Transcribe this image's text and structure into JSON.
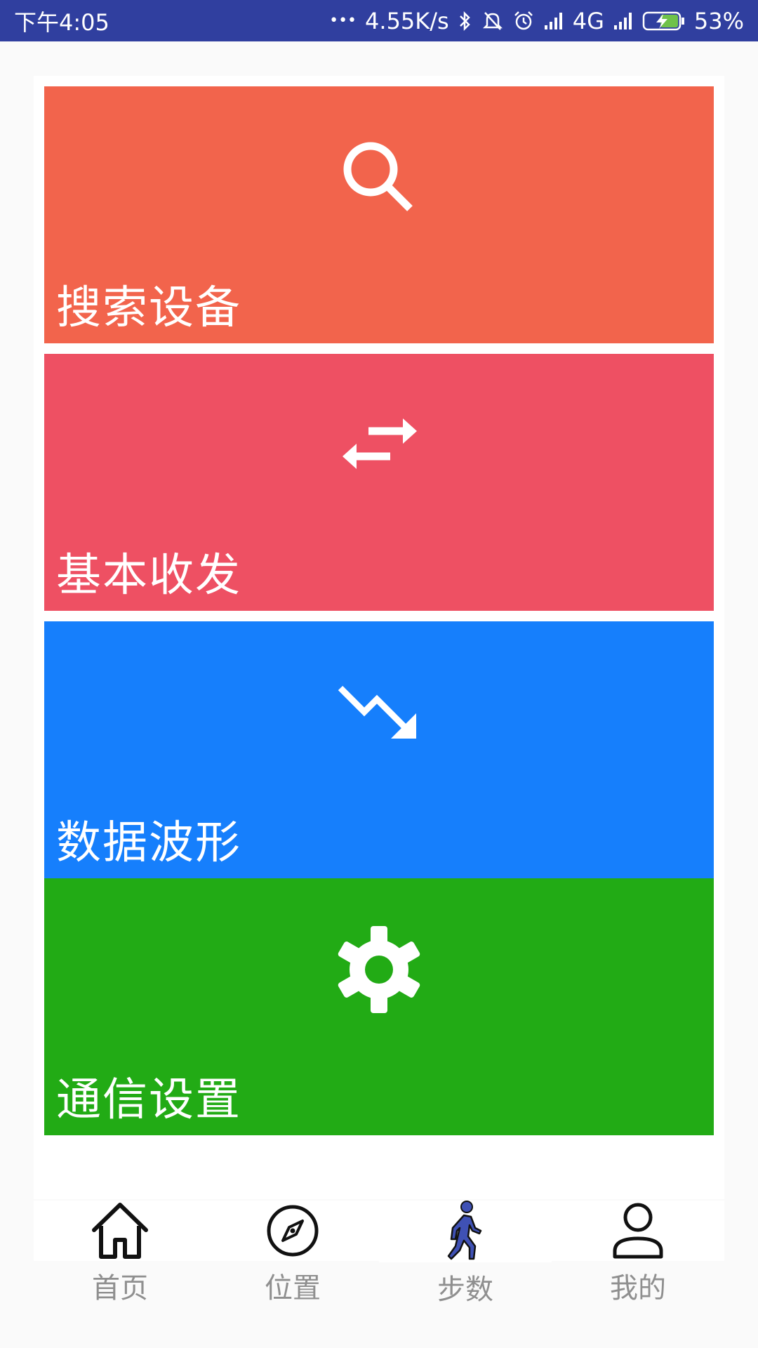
{
  "status_bar": {
    "time": "下午4:05",
    "dots": "•••",
    "net_speed": "4.55K/s",
    "network_type": "4G",
    "battery_percent": "53%",
    "icons": [
      "bluetooth-icon",
      "mute-bell-icon",
      "alarm-icon",
      "signal-icon",
      "signal-icon",
      "battery-charging-icon"
    ]
  },
  "tiles": [
    {
      "label": "搜索设备",
      "icon": "search-icon",
      "color": "#f2644c"
    },
    {
      "label": "基本收发",
      "icon": "swap-arrows-icon",
      "color": "#ee5063"
    },
    {
      "label": "数据波形",
      "icon": "trending-down-icon",
      "color": "#167ffc"
    },
    {
      "label": "通信设置",
      "icon": "gear-icon",
      "color": "#22ab15"
    }
  ],
  "bottom_nav": {
    "items": [
      {
        "label": "首页",
        "icon": "home-icon"
      },
      {
        "label": "位置",
        "icon": "compass-icon"
      },
      {
        "label": "步数",
        "icon": "walking-icon"
      },
      {
        "label": "我的",
        "icon": "person-icon"
      }
    ]
  },
  "colors": {
    "status_bar": "#303f9f",
    "background": "#fafafa",
    "nav_label": "#8f8f8f"
  }
}
